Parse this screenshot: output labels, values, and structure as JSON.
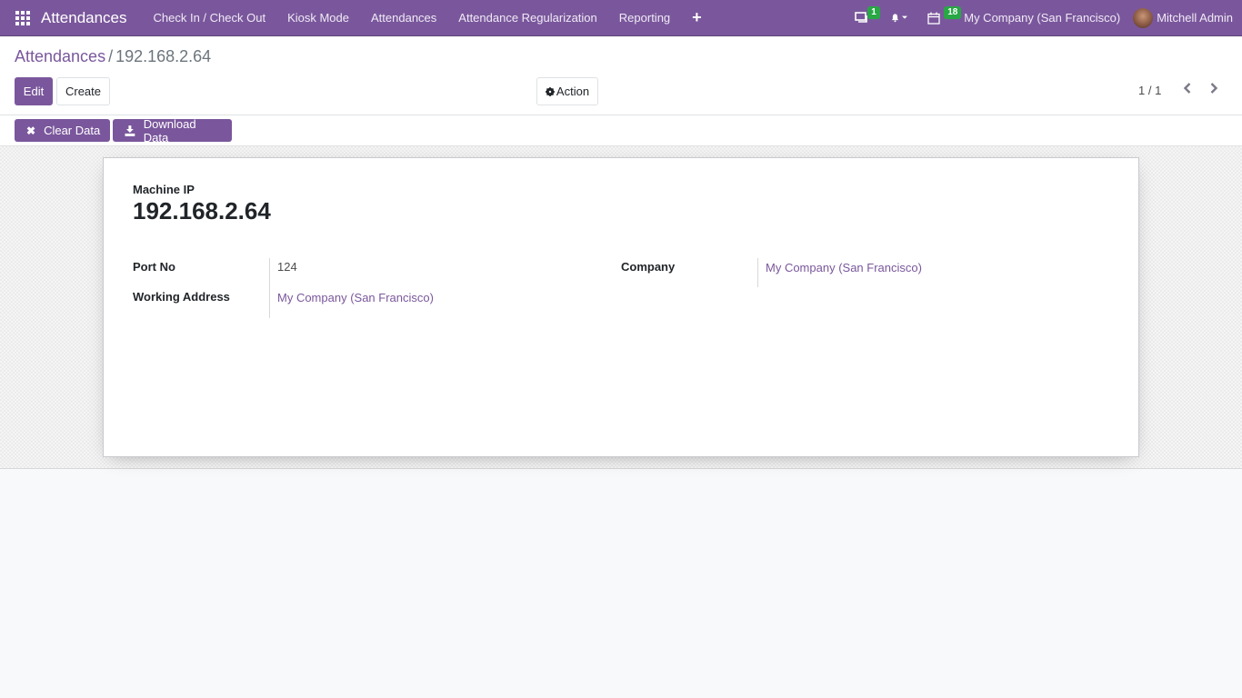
{
  "navbar": {
    "app_name": "Attendances",
    "menu": [
      "Check In / Check Out",
      "Kiosk Mode",
      "Attendances",
      "Attendance Regularization",
      "Reporting"
    ],
    "plus_icon": "+",
    "messages_badge": "1",
    "activities_badge": "18",
    "company": "My Company (San Francisco)",
    "user": "Mitchell Admin"
  },
  "breadcrumb": {
    "parent": "Attendances",
    "separator": "/",
    "current": "192.168.2.64"
  },
  "buttons": {
    "edit": "Edit",
    "create": "Create",
    "action": "Action",
    "clear_data": "Clear Data",
    "download_data": "Download Data"
  },
  "pager": {
    "value": "1 / 1"
  },
  "form": {
    "title_label": "Machine IP",
    "title_value": "192.168.2.64",
    "fields": {
      "port_label": "Port No",
      "port_value": "124",
      "address_label": "Working Address",
      "address_value": "My Company (San Francisco)",
      "company_label": "Company",
      "company_value": "My Company (San Francisco)"
    }
  },
  "colors": {
    "brand": "#7a579c",
    "badge": "#28a745"
  }
}
